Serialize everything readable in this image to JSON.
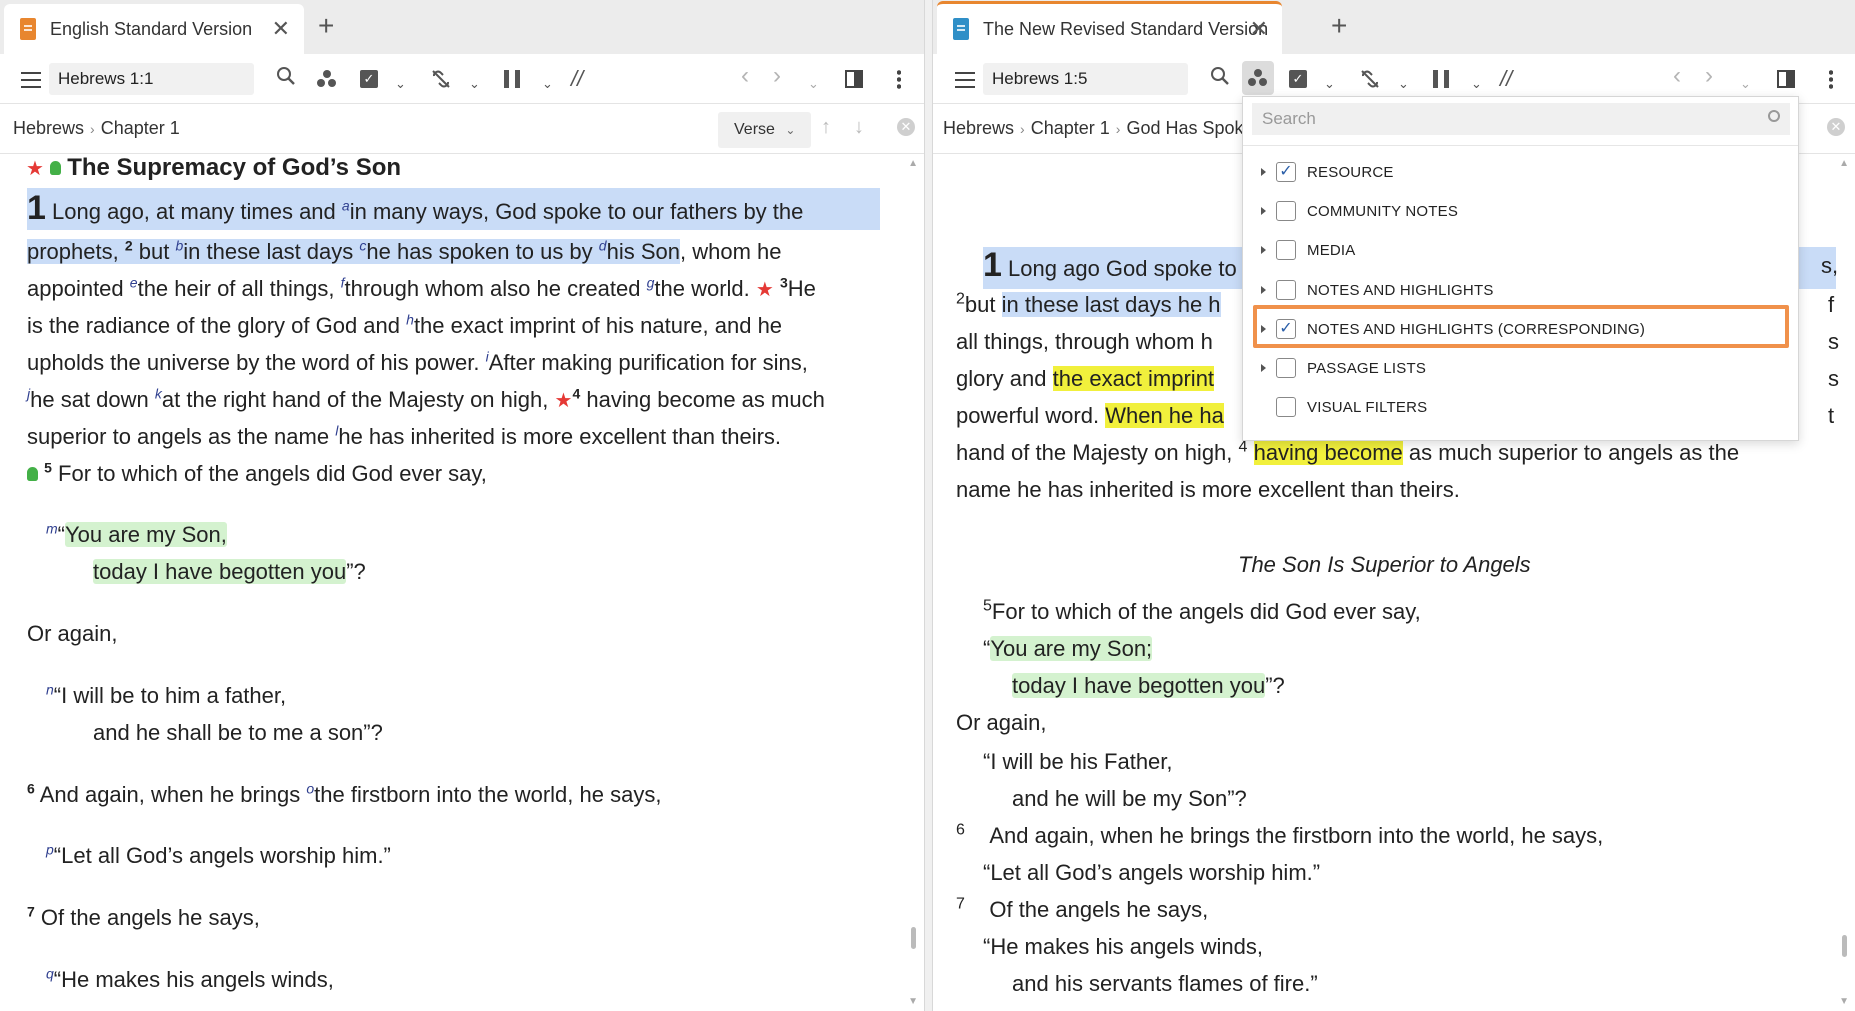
{
  "left": {
    "tab": {
      "title": "English Standard Version",
      "close": "✕",
      "add": "+"
    },
    "toolbar": {
      "reference": "Hebrews 1:1",
      "parallel": "//"
    },
    "breadcrumb": [
      "Hebrews",
      "Chapter 1"
    ],
    "verse_mode": "Verse",
    "heading": "The Supremacy of God’s Son",
    "text": {
      "v1_num": "1",
      "l1": "Long ago, at many times and",
      "fn_a": "a",
      "l1b": "in many ways, God spoke to our fathers by the",
      "l2a": "prophets,",
      "v2": "2",
      "l2b": "but",
      "fn_b": "b",
      "l2c": "in these last days",
      "fn_c": "c",
      "l2d": "he has spoken to us by",
      "fn_d": "d",
      "l2e": "his Son",
      "l2f": ", whom he",
      "l3a": "appointed",
      "fn_e": "e",
      "l3b": "the heir of all things,",
      "fn_f": "f",
      "l3c": "through whom also he created",
      "fn_g": "g",
      "l3d": "the world.",
      "v3": "3",
      "l3e": "He",
      "l4a": "is the radiance of the glory of God and",
      "fn_h": "h",
      "l4b": "the exact imprint of his nature, and he",
      "l5a": "upholds the universe by the word of his power.",
      "fn_i": "i",
      "l5b": "After making purification for sins,",
      "fn_j": "j",
      "l6a": "he sat down",
      "fn_k": "k",
      "l6b": "at the right hand of the Majesty on high,",
      "v4": "4",
      "l6c": "having become as much",
      "l7a": "superior to angels as the name",
      "fn_l": "l",
      "l7b": "he has inherited is more excellent than theirs.",
      "v5": "5",
      "l8": "For to which of the angels did God ever say,",
      "fn_m": "m",
      "q1a": "“",
      "q1b": "You are my Son,",
      "q2": "today I have begotten you",
      "q2end": "”?",
      "again1": "Or again,",
      "fn_n": "n",
      "q3": "“I will be to him a father,",
      "q4": "and he shall be to me a son”?",
      "v6": "6",
      "l9a": "And again, when he brings",
      "fn_o": "o",
      "l9b": "the firstborn into the world, he says,",
      "fn_p": "p",
      "q5": "“Let all God’s angels worship him.”",
      "v7": "7",
      "l10": "Of the angels he says,",
      "fn_q": "q",
      "q6": "“He makes his angels winds,"
    }
  },
  "right": {
    "tab": {
      "title": "The New Revised Standard Version",
      "close": "✕",
      "add": "+"
    },
    "toolbar": {
      "reference": "Hebrews 1:5",
      "parallel": "//"
    },
    "breadcrumb": [
      "Hebrews",
      "Chapter 1",
      "God Has Spok"
    ],
    "text": {
      "v1_num": "1",
      "l1": "Long ago God spoke to o",
      "l1_tail": "s,",
      "v2": "2",
      "l2a": "but",
      "l2b": "in these last days he h",
      "l2_tail": "f",
      "l3": "all things, through whom h",
      "l3_tail": "s",
      "l4a": "glory and",
      "l4b": "the exact imprint",
      "l4_tail": "s",
      "l5a": "powerful word.",
      "l5b": "When he ha",
      "l5_tail": "t",
      "l6a": "hand of the Majesty on high,",
      "v4": "4",
      "l6b": "having become",
      "l6c": "as much superior to angels as the",
      "l7": "name he has inherited is more excellent than theirs.",
      "subheading": "The Son Is Superior to Angels",
      "v5": "5",
      "l8": "For to which of the angels did God ever say,",
      "q1a": "“",
      "q1b": "You are my Son;",
      "q2": "today I have begotten you",
      "q2end": "”?",
      "again": "Or again,",
      "q3": "“I will be his Father,",
      "q4": "and he will be my Son”?",
      "v6": "6",
      "l9": "And again, when he brings the firstborn into the world, he says,",
      "q5": "“Let all God’s angels worship him.”",
      "v7": "7",
      "l10": "Of the angels he says,",
      "q6": "“He makes his angels winds,",
      "q7": "and his servants flames of fire.”"
    }
  },
  "dropdown": {
    "search_placeholder": "Search",
    "items": [
      {
        "label": "RESOURCE",
        "checked": true,
        "expandable": true
      },
      {
        "label": "COMMUNITY NOTES",
        "checked": false,
        "expandable": true
      },
      {
        "label": "MEDIA",
        "checked": false,
        "expandable": true
      },
      {
        "label": "NOTES AND HIGHLIGHTS",
        "checked": false,
        "expandable": true
      },
      {
        "label": "NOTES AND HIGHLIGHTS (CORRESPONDING)",
        "checked": true,
        "expandable": true,
        "highlighted": true
      },
      {
        "label": "PASSAGE LISTS",
        "checked": false,
        "expandable": true
      },
      {
        "label": "VISUAL FILTERS",
        "checked": false,
        "expandable": false
      }
    ],
    "check_glyph": "✓"
  },
  "colors": {
    "accent": "#e8862f",
    "highlight_blue": "#c9dcf7",
    "highlight_green": "#d4f2cf",
    "highlight_yellow": "#f1f03c",
    "callout_orange": "#f0914b",
    "star_red": "#e53935"
  }
}
